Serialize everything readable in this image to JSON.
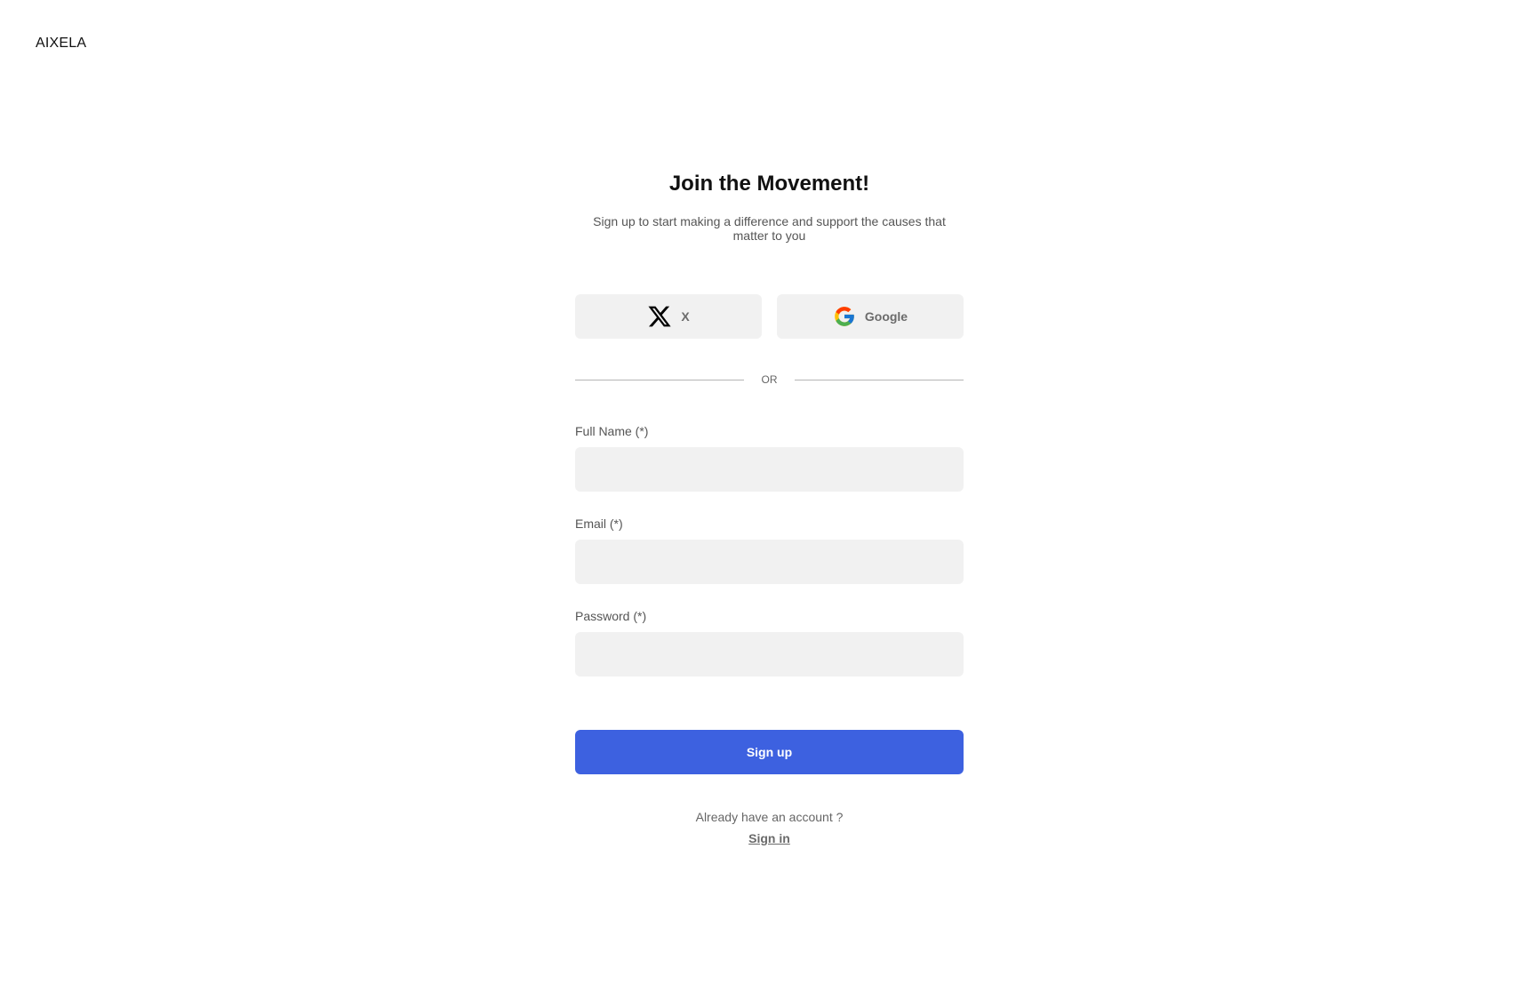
{
  "brand": {
    "name": "AIXELA"
  },
  "heading": {
    "title": "Join the Movement!",
    "subtitle": "Sign up to start making a difference and support the causes that matter to you"
  },
  "social": {
    "x_label": "X",
    "x_icon": "x-logo-icon",
    "google_label": "Google",
    "google_icon": "google-logo-icon"
  },
  "divider": {
    "label": "OR"
  },
  "form": {
    "full_name": {
      "label": "Full Name (*)",
      "value": "",
      "placeholder": ""
    },
    "email": {
      "label": "Email (*)",
      "value": "",
      "placeholder": ""
    },
    "password": {
      "label": "Password (*)",
      "value": "",
      "placeholder": ""
    },
    "submit_label": "Sign up"
  },
  "footer": {
    "question": "Already have an account ?",
    "signin_label": "Sign in"
  },
  "colors": {
    "primary": "#3d61e0",
    "input_bg": "#f1f1f1",
    "text_muted": "#555555"
  }
}
